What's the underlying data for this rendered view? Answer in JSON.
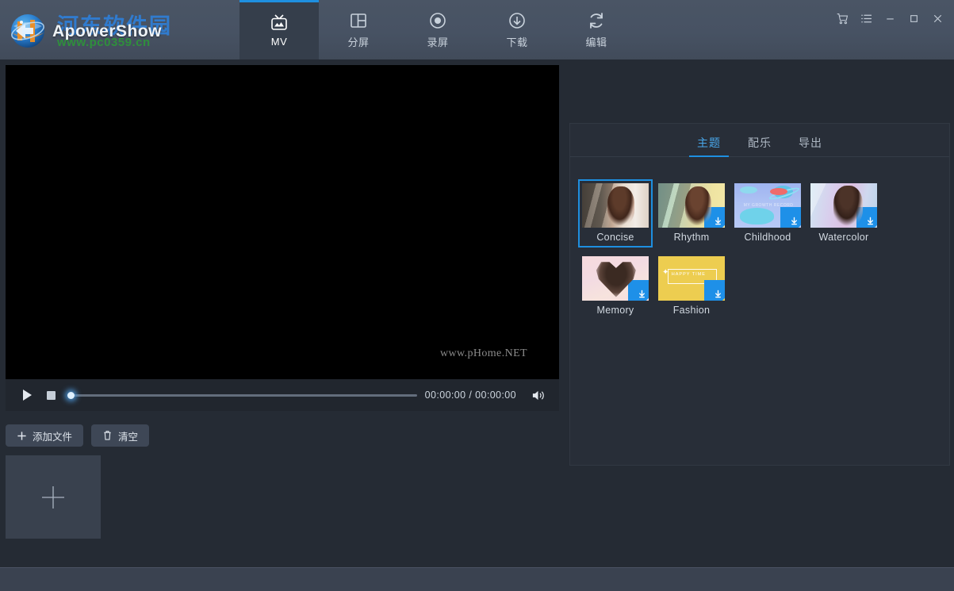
{
  "app": {
    "brand_name": "ApowerShow",
    "watermark_cn": "河东软件园",
    "watermark_url": "www.pc0359.cn",
    "accent_color": "#1e8fe0",
    "titlebar_color": "#475263",
    "panel_color": "#282e38"
  },
  "main_tabs": [
    {
      "label": "MV",
      "icon": "tv-icon",
      "active": true
    },
    {
      "label": "分屏",
      "icon": "split-screen-icon",
      "active": false
    },
    {
      "label": "录屏",
      "icon": "record-icon",
      "active": false
    },
    {
      "label": "下载",
      "icon": "download-icon",
      "active": false
    },
    {
      "label": "编辑",
      "icon": "refresh-edit-icon",
      "active": false
    }
  ],
  "window_controls": [
    {
      "name": "cart-icon",
      "title": "购物车"
    },
    {
      "name": "menu-list-icon",
      "title": "菜单"
    },
    {
      "name": "minimize-icon",
      "title": "最小化"
    },
    {
      "name": "maximize-icon",
      "title": "最大化"
    },
    {
      "name": "close-icon",
      "title": "关闭"
    }
  ],
  "preview": {
    "watermark": "www.pHome.NET",
    "background_color": "#000000"
  },
  "player": {
    "play_label": "播放",
    "stop_label": "停止",
    "current_time": "00:00:00",
    "total_time": "00:00:00",
    "time_display": "00:00:00 / 00:00:00",
    "progress_percent": 0,
    "volume_icon": "volume-icon"
  },
  "file_toolbar": {
    "add_file_label": "添加文件",
    "add_file_icon": "plus-icon",
    "clear_label": "清空",
    "clear_icon": "trash-icon"
  },
  "media_tray": {
    "add_cell_icon": "plus-icon",
    "add_cell_label": "添加媒体"
  },
  "right_panel": {
    "tabs": [
      {
        "label": "主题",
        "active": true
      },
      {
        "label": "配乐",
        "active": false
      },
      {
        "label": "导出",
        "active": false
      }
    ],
    "themes": [
      {
        "name": "Concise",
        "style": "th-concise",
        "selected": true,
        "downloadable": false
      },
      {
        "name": "Rhythm",
        "style": "th-rhythm",
        "selected": false,
        "downloadable": true
      },
      {
        "name": "Childhood",
        "style": "th-child",
        "selected": false,
        "downloadable": true,
        "caption": "MY GROWTH RECORD"
      },
      {
        "name": "Watercolor",
        "style": "th-water",
        "selected": false,
        "downloadable": true
      },
      {
        "name": "Memory",
        "style": "th-memory",
        "selected": false,
        "downloadable": true
      },
      {
        "name": "Fashion",
        "style": "th-fashion",
        "selected": false,
        "downloadable": true,
        "caption": "HAPPY TIME"
      }
    ]
  }
}
